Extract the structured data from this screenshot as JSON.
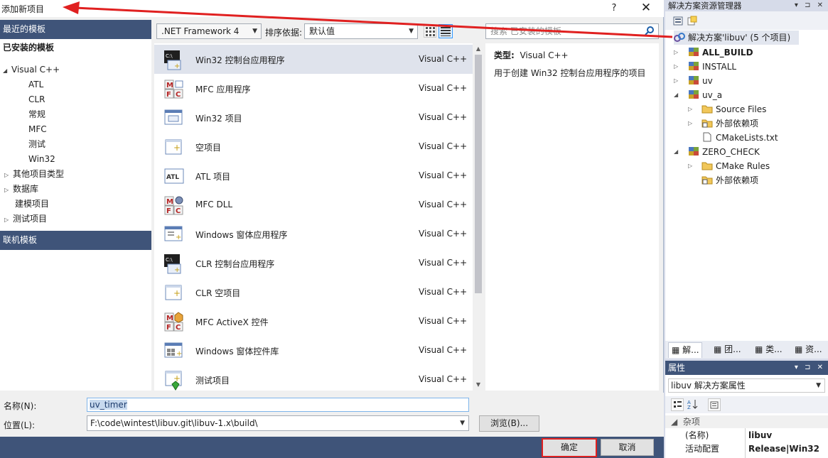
{
  "dialog": {
    "title": "添加新项目",
    "help": "?",
    "close": "✕",
    "left": {
      "recent": "最近的模板",
      "installed": "已安装的模板",
      "tree": [
        {
          "label": "Visual C++",
          "expanded": true
        },
        {
          "label": "ATL"
        },
        {
          "label": "CLR"
        },
        {
          "label": "常规"
        },
        {
          "label": "MFC"
        },
        {
          "label": "测试"
        },
        {
          "label": "Win32"
        },
        {
          "label": "其他项目类型",
          "collapsed": true
        },
        {
          "label": "数据库",
          "collapsed": true
        },
        {
          "label": "建模项目"
        },
        {
          "label": "测试项目",
          "collapsed": true
        }
      ],
      "online": "联机模板"
    },
    "toolbar": {
      "framework": ".NET Framework 4",
      "sort_label": "排序依据:",
      "sort_value": "默认值",
      "search_placeholder": "搜索 已安装的模板"
    },
    "templates": [
      {
        "name": "Win32 控制台应用程序",
        "lang": "Visual C++",
        "icon": "console-app-icon",
        "selected": true
      },
      {
        "name": "MFC 应用程序",
        "lang": "Visual C++",
        "icon": "mfc-app-icon"
      },
      {
        "name": "Win32 项目",
        "lang": "Visual C++",
        "icon": "win32-project-icon"
      },
      {
        "name": "空项目",
        "lang": "Visual C++",
        "icon": "empty-project-icon"
      },
      {
        "name": "ATL 项目",
        "lang": "Visual C++",
        "icon": "atl-project-icon"
      },
      {
        "name": "MFC DLL",
        "lang": "Visual C++",
        "icon": "mfc-dll-icon"
      },
      {
        "name": "Windows 窗体应用程序",
        "lang": "Visual C++",
        "icon": "windows-forms-app-icon"
      },
      {
        "name": "CLR 控制台应用程序",
        "lang": "Visual C++",
        "icon": "clr-console-icon"
      },
      {
        "name": "CLR 空项目",
        "lang": "Visual C++",
        "icon": "clr-empty-icon"
      },
      {
        "name": "MFC ActiveX 控件",
        "lang": "Visual C++",
        "icon": "mfc-activex-icon"
      },
      {
        "name": "Windows 窗体控件库",
        "lang": "Visual C++",
        "icon": "forms-control-library-icon"
      },
      {
        "name": "测试项目",
        "lang": "Visual C++",
        "icon": "test-project-icon"
      }
    ],
    "description": {
      "type_label": "类型:",
      "type_value": "Visual C++",
      "text": "用于创建 Win32 控制台应用程序的项目"
    },
    "bottom": {
      "name_label": "名称(N):",
      "name_value": "uv_timer",
      "location_label": "位置(L):",
      "location_value": "F:\\code\\wintest\\libuv.git\\libuv-1.x\\build\\",
      "browse": "浏览(B)...",
      "ok": "确定",
      "cancel": "取消"
    }
  },
  "solution_explorer": {
    "title": "解决方案资源管理器",
    "pin": "▾ ⊐ ✕",
    "root": "解决方案'libuv' (5 个项目)",
    "nodes": [
      {
        "label": "ALL_BUILD",
        "bold": true
      },
      {
        "label": "INSTALL"
      },
      {
        "label": "uv"
      },
      {
        "label": "uv_a"
      },
      {
        "label": "Source Files"
      },
      {
        "label": "外部依赖项"
      },
      {
        "label": "CMakeLists.txt"
      },
      {
        "label": "ZERO_CHECK"
      },
      {
        "label": "CMake Rules"
      },
      {
        "label": "外部依赖项"
      }
    ],
    "tabs": [
      "解...",
      "团...",
      "类...",
      "资..."
    ]
  },
  "properties": {
    "title": "属性",
    "pin": "▾ ⊐ ✕",
    "object": "libuv 解决方案属性",
    "category": "杂项",
    "rows": [
      {
        "key": "(名称)",
        "value": "libuv"
      },
      {
        "key": "活动配置",
        "value": "Release|Win32"
      }
    ]
  },
  "colors": {
    "header_blue": "#3f5479",
    "annotation_red": "#e02020"
  }
}
